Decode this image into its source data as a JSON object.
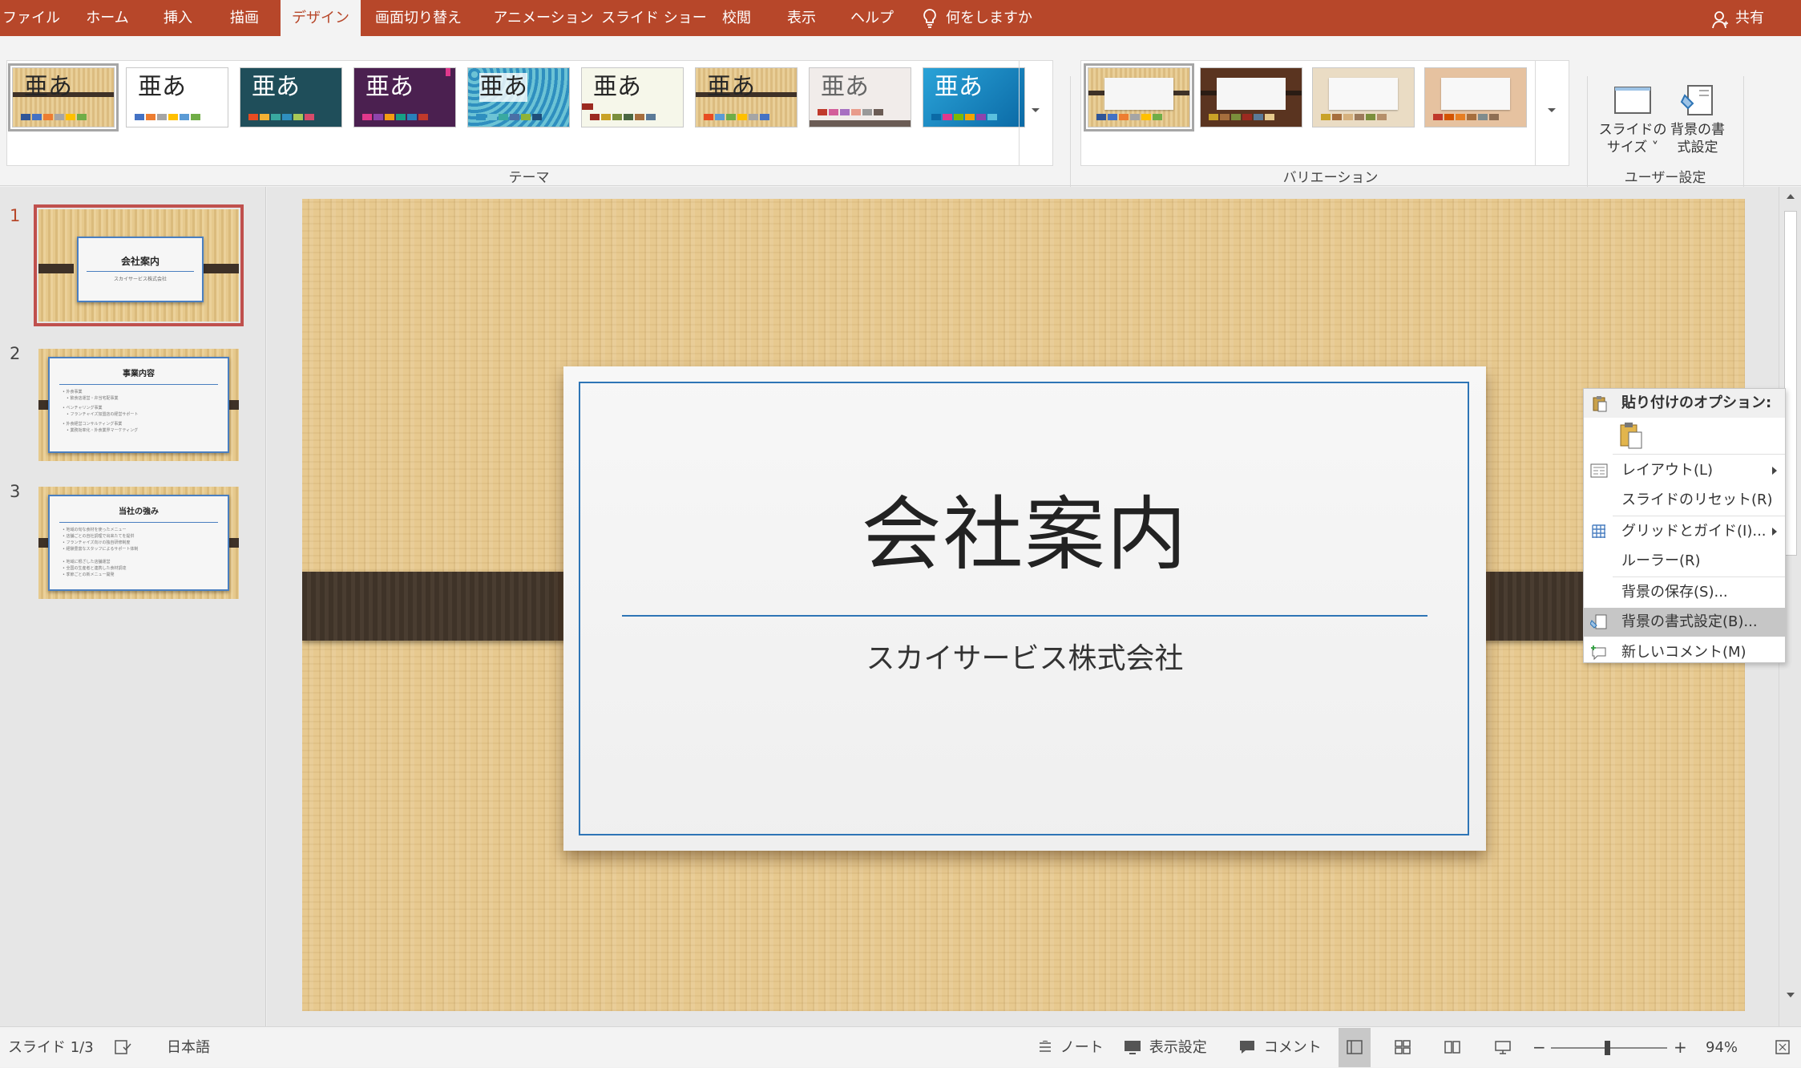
{
  "tabs": [
    {
      "label": "ファイル",
      "active": false
    },
    {
      "label": "ホーム",
      "active": false
    },
    {
      "label": "挿入",
      "active": false
    },
    {
      "label": "描画",
      "active": false
    },
    {
      "label": "デザイン",
      "active": true
    },
    {
      "label": "画面切り替え",
      "active": false
    },
    {
      "label": "アニメーション",
      "active": false
    },
    {
      "label": "スライド ショー",
      "active": false
    },
    {
      "label": "校閲",
      "active": false
    },
    {
      "label": "表示",
      "active": false
    },
    {
      "label": "ヘルプ",
      "active": false
    }
  ],
  "tell_me": "何をしますか",
  "share": "共有",
  "ribbon": {
    "themes_label": "テーマ",
    "variations_label": "バリエーション",
    "customize_label": "ユーザー設定",
    "theme_text": "亜あ",
    "slide_size": {
      "line1": "スライドの",
      "line2": "サイズ ˅"
    },
    "format_bg": {
      "line1": "背景の書",
      "line2": "式設定"
    }
  },
  "slides_pane": [
    {
      "number": "1",
      "title": "会社案内",
      "subtitle": "スカイサービス株式会社"
    },
    {
      "number": "2",
      "title": "事業内容",
      "bullets": [
        "• 外食事業",
        "　• 飲食店運営・弁当宅配事業",
        "• ベンチャリング事業",
        "　• フランチャイズ加盟店の経営サポート",
        "• 外食経営コンサルティング事業",
        "　• 業務効率化・外食業界マーケティング"
      ]
    },
    {
      "number": "3",
      "title": "当社の強み",
      "bullets": [
        "• 地域の旬な食材を使ったメニュー",
        "• 店舗ごとの自社調理で出来たてを提供",
        "• フランチャイズ向けの独自研修制度",
        "• 経験豊富なスタッフによるサポート体制",
        "",
        "• 地域に根ざした店舗運営",
        "• 全国の生産者と連携した食材調達",
        "• 季節ごとの新メニュー開発"
      ]
    }
  ],
  "slide": {
    "title": "会社案内",
    "subtitle": "スカイサービス株式会社"
  },
  "context_menu": {
    "header": "貼り付けのオプション:",
    "items": [
      {
        "label": "レイアウト(L)",
        "submenu": true
      },
      {
        "label": "スライドのリセット(R)",
        "submenu": false
      },
      {
        "label": "グリッドとガイド(I)...",
        "submenu": true
      },
      {
        "label": "ルーラー(R)",
        "submenu": false
      },
      {
        "label": "背景の保存(S)...",
        "submenu": false
      },
      {
        "label": "背景の書式設定(B)...",
        "submenu": false,
        "highlighted": true
      },
      {
        "label": "新しいコメント(M)",
        "submenu": false
      }
    ]
  },
  "status": {
    "slide_count": "スライド 1/3",
    "language": "日本語",
    "notes": "ノート",
    "display_settings": "表示設定",
    "comments": "コメント",
    "zoom": "94%"
  },
  "colors": {
    "accent": "#b7472a",
    "slide_border": "#2e75b6",
    "strap": "#3e3127"
  }
}
